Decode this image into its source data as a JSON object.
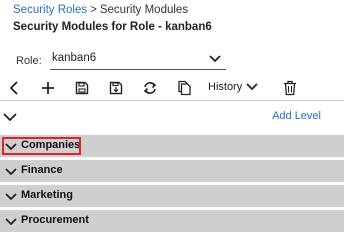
{
  "breadcrumb": {
    "link": "Security Roles",
    "separator": ">",
    "current": "Security Modules"
  },
  "page_title": "Security Modules for Role - kanban6",
  "role": {
    "label": "Role:",
    "value": "kanban6"
  },
  "toolbar": {
    "icons": [
      "back-icon",
      "add-icon",
      "save-icon",
      "save-as-icon",
      "refresh-icon",
      "copy-icon",
      "history-chevron-icon",
      "delete-icon"
    ],
    "history_label": "History"
  },
  "add_level_label": "Add Level",
  "modules": [
    {
      "label": "Companies",
      "selected": true
    },
    {
      "label": "Finance"
    },
    {
      "label": "Marketing"
    },
    {
      "label": "Procurement"
    }
  ],
  "colors": {
    "link": "#2a6fc0",
    "row_bg": "#cfcfcf",
    "highlight": "#d9232d"
  }
}
